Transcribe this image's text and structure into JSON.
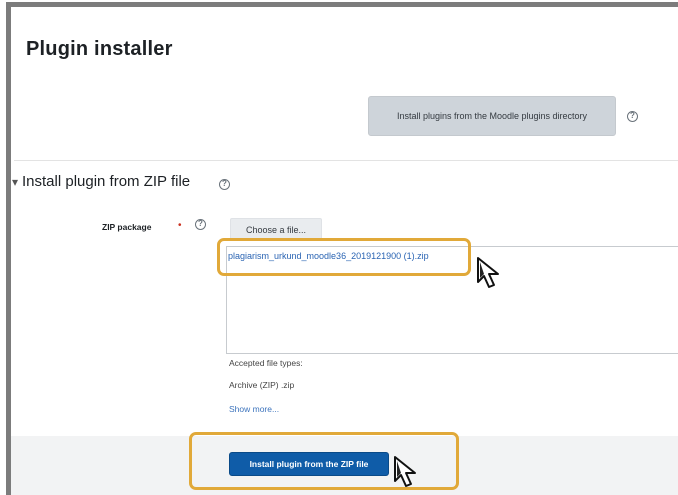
{
  "header": {
    "page_title": "Plugin installer"
  },
  "directory_button": {
    "label": "Install plugins from the Moodle plugins directory"
  },
  "zip_section": {
    "title": "Install plugin from ZIP file",
    "caret": "▾",
    "zip_label": "ZIP package",
    "required_mark": "•",
    "choose_button": "Choose a file...",
    "selected_file": "plagiarism_urkund_moodle36_2019121900 (1).zip",
    "accepted_types_label": "Accepted file types:",
    "archive_type": "Archive (ZIP) .zip",
    "show_more": "Show more..."
  },
  "footer": {
    "install_button": "Install plugin from the ZIP file"
  },
  "icons": {
    "help": "question-circle-icon",
    "cursor": "mouse-pointer-icon"
  },
  "colors": {
    "highlight": "#e1a939",
    "primary_button": "#0f5ca8",
    "link": "#2a64b3"
  }
}
